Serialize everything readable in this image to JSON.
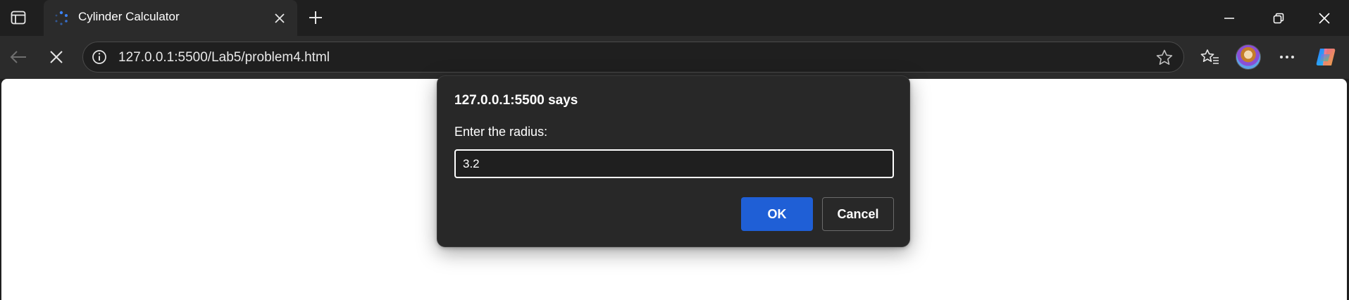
{
  "browser": {
    "tab": {
      "title": "Cylinder Calculator",
      "favicon": "loading-spinner-icon"
    },
    "address_bar": {
      "url": "127.0.0.1:5500/Lab5/problem4.html"
    },
    "icons": {
      "tab_actions": "tab-actions-icon",
      "close_tab": "close-icon",
      "new_tab": "plus-icon",
      "back": "back-arrow-icon",
      "stop": "stop-icon",
      "site_info": "info-icon",
      "favorite": "star-icon",
      "favorites": "favorites-icon",
      "profile": "avatar",
      "more": "more-icon",
      "copilot": "copilot-icon"
    },
    "window_controls": [
      "minimize",
      "restore",
      "close"
    ]
  },
  "dialog": {
    "title": "127.0.0.1:5500 says",
    "message": "Enter the radius:",
    "input_value": "3.2",
    "ok_label": "OK",
    "cancel_label": "Cancel"
  },
  "colors": {
    "accent": "#1f5fd6",
    "chrome_dark": "#1f1f1f",
    "toolbar": "#2b2b2b",
    "dialog_bg": "#282828"
  }
}
